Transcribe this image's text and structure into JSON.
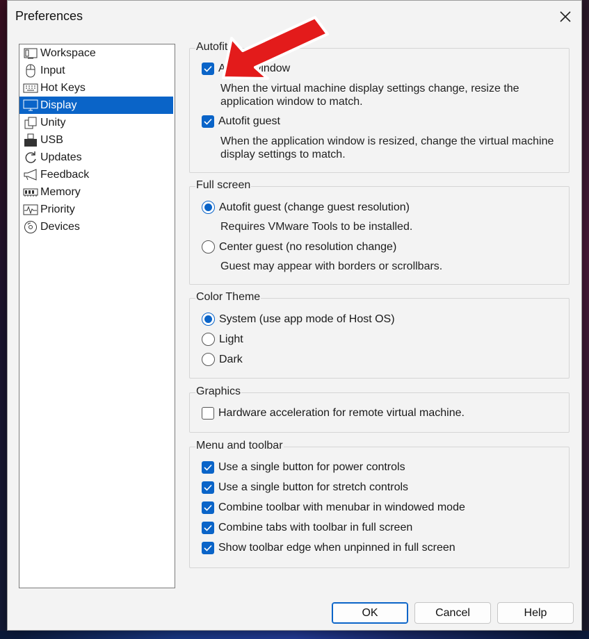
{
  "window": {
    "title": "Preferences"
  },
  "sidebar": {
    "items": [
      {
        "label": "Workspace",
        "icon": "workspace-icon",
        "selected": false
      },
      {
        "label": "Input",
        "icon": "mouse-icon",
        "selected": false
      },
      {
        "label": "Hot Keys",
        "icon": "keyboard-icon",
        "selected": false
      },
      {
        "label": "Display",
        "icon": "monitor-icon",
        "selected": true
      },
      {
        "label": "Unity",
        "icon": "unity-icon",
        "selected": false
      },
      {
        "label": "USB",
        "icon": "usb-icon",
        "selected": false
      },
      {
        "label": "Updates",
        "icon": "refresh-icon",
        "selected": false
      },
      {
        "label": "Feedback",
        "icon": "megaphone-icon",
        "selected": false
      },
      {
        "label": "Memory",
        "icon": "memory-icon",
        "selected": false
      },
      {
        "label": "Priority",
        "icon": "pulse-icon",
        "selected": false
      },
      {
        "label": "Devices",
        "icon": "disc-icon",
        "selected": false
      }
    ]
  },
  "autofit": {
    "title": "Autofit",
    "window_label": "Autofit window",
    "window_checked": true,
    "window_desc": "When the virtual machine display settings change, resize the application window to match.",
    "guest_label": "Autofit guest",
    "guest_checked": true,
    "guest_desc": "When the application window is resized, change the virtual machine display settings to match."
  },
  "fullscreen": {
    "title": "Full screen",
    "opt1_label": "Autofit guest (change guest resolution)",
    "opt1_desc": "Requires VMware Tools to be installed.",
    "opt2_label": "Center guest (no resolution change)",
    "opt2_desc": "Guest may appear with borders or scrollbars.",
    "selected": "opt1"
  },
  "theme": {
    "title": "Color Theme",
    "options": [
      "System (use app mode of Host OS)",
      "Light",
      "Dark"
    ],
    "selected": 0
  },
  "graphics": {
    "title": "Graphics",
    "hw_label": "Hardware acceleration for remote virtual machine.",
    "hw_checked": false
  },
  "menu_toolbar": {
    "title": "Menu and toolbar",
    "items": [
      {
        "label": "Use a single button for power controls",
        "checked": true
      },
      {
        "label": "Use a single button for stretch controls",
        "checked": true
      },
      {
        "label": "Combine toolbar with menubar in windowed mode",
        "checked": true
      },
      {
        "label": "Combine tabs with toolbar in full screen",
        "checked": true
      },
      {
        "label": "Show toolbar edge when unpinned in full screen",
        "checked": true
      }
    ]
  },
  "buttons": {
    "ok": "OK",
    "cancel": "Cancel",
    "help": "Help"
  },
  "colors": {
    "accent": "#0a64c8",
    "annotation_arrow": "#e31b1b"
  }
}
